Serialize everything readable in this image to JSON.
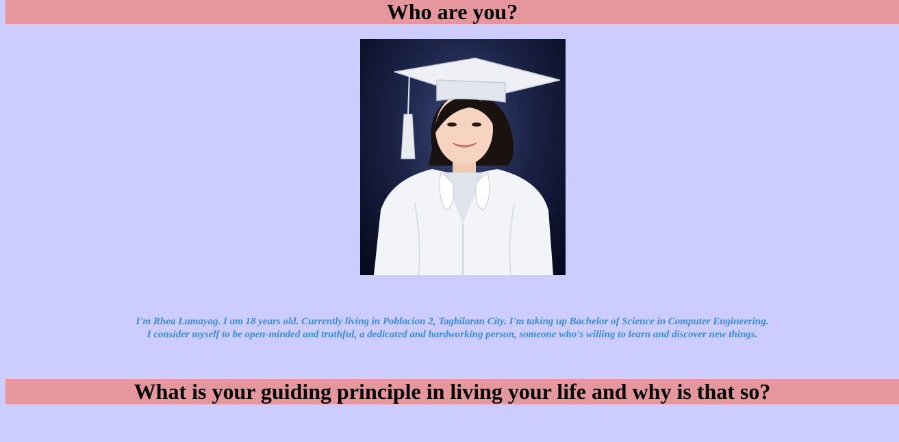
{
  "sections": [
    {
      "title": "Who are you?",
      "intro_line1": "I'm Rhea Lumayag. I am 18 years old. Currently living in Poblacion 2, Tagbilaran City. I'm taking up Bachelor of Science in Computer Engineering.",
      "intro_line2": "I consider myself to be open-minded and truthful, a dedicated and hardworking person, someone who's willing to learn and discover new things."
    },
    {
      "title": "What is your guiding principle in living your life and why is that so?"
    }
  ],
  "colors": {
    "page_background": "#ccccff",
    "heading_background": "#e6979e",
    "intro_text": "#3a8ddd"
  },
  "photo": {
    "icon": "graduation-portrait-photo"
  }
}
